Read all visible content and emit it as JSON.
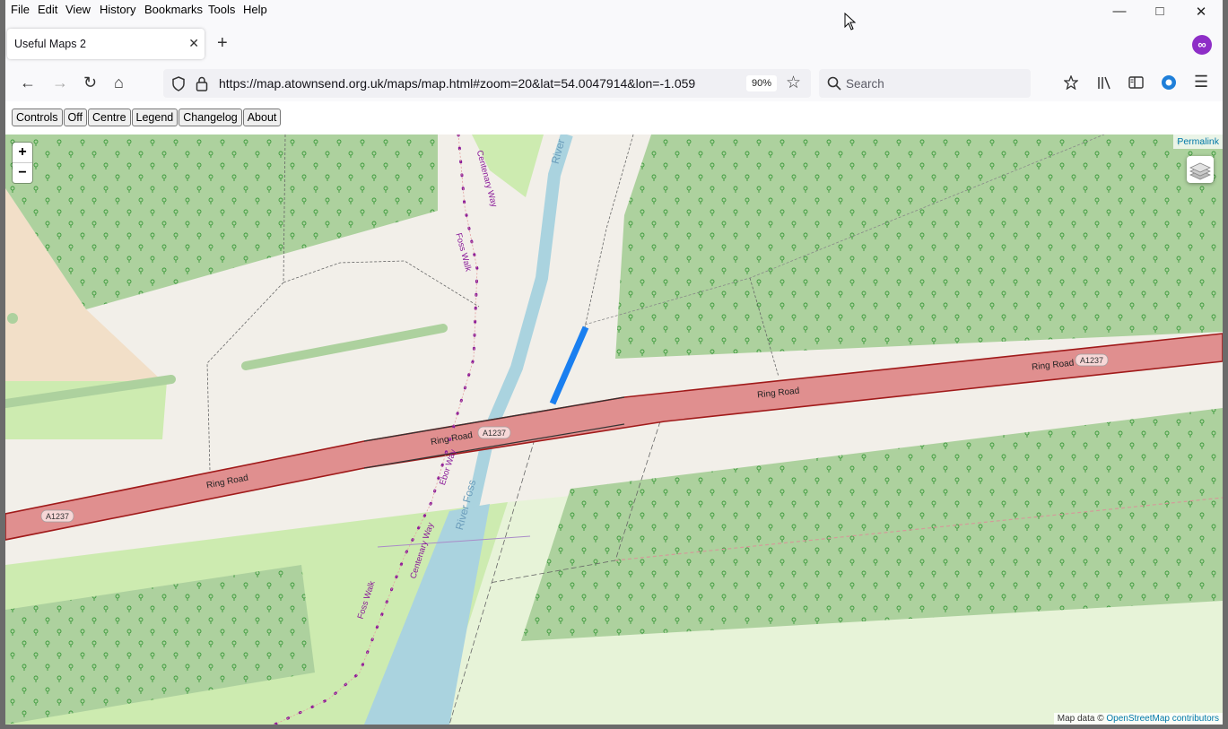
{
  "menu": [
    "File",
    "Edit",
    "View",
    "History",
    "Bookmarks",
    "Tools",
    "Help"
  ],
  "tab": {
    "title": "Useful Maps 2"
  },
  "url": "https://map.atownsend.org.uk/maps/map.html#zoom=20&lat=54.0047914&lon=-1.059",
  "zoom_level": "90%",
  "search": {
    "placeholder": "Search"
  },
  "controls": [
    "Controls",
    "Off",
    "Centre",
    "Legend",
    "Changelog",
    "About"
  ],
  "map": {
    "zoom_in": "+",
    "zoom_out": "−",
    "permalink": "Permalink",
    "attribution_prefix": "Map data ©",
    "attribution_link": "OpenStreetMap contributors",
    "labels": {
      "ring_road_1": "Ring Road",
      "ring_road_2": "Ring Road",
      "ring_road_3": "Ring Road",
      "ring_road_4": "Ring Road",
      "shield_1": "A1237",
      "shield_2": "A1237",
      "shield_3": "A1237",
      "river_1": "River Foss",
      "river_2": "River",
      "centenary_1": "Centenary Way",
      "centenary_2": "Centenary Way",
      "foss_walk_1": "Foss Walk",
      "foss_walk_2": "Foss Walk",
      "ebor_way": "Ebor Way"
    }
  },
  "colors": {
    "road": "#e08f8f",
    "road_edge": "#a01a1a",
    "forest": "#add19e",
    "grass": "#cdebb0",
    "water": "#aad3df",
    "route": "#8a1a99",
    "highlight": "#1a7ff0"
  }
}
